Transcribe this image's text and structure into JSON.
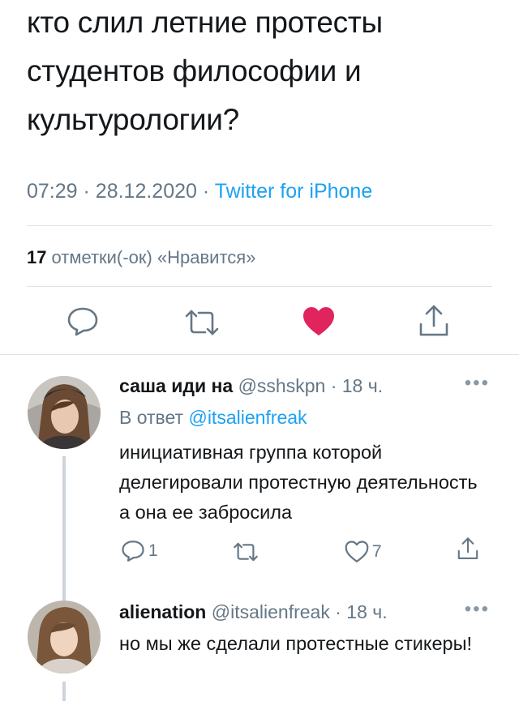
{
  "tweet": {
    "text": "кто слил летние протесты студентов философии и культурологии?",
    "time": "07:29",
    "separator": "·",
    "date": "28.12.2020",
    "source": "Twitter for iPhone",
    "likes_count": "17",
    "likes_label": "отметки(-ок) «Нравится»",
    "liked_color": "#e0245e"
  },
  "replies": [
    {
      "display_name": "саша иди на",
      "handle": "@sshskpn",
      "separator": "·",
      "age": "18 ч.",
      "reply_prefix": "В ответ",
      "reply_to": "@itsalienfreak",
      "text": "инициативная группа которой делегировали протестную деятельность а она ее забросила",
      "reply_count": "1",
      "like_count": "7"
    },
    {
      "display_name": "alienation",
      "handle": "@itsalienfreak",
      "separator": "·",
      "age": "18 ч.",
      "text": "но мы же сделали протестные стикеры!"
    }
  ],
  "icons": {
    "reply": "reply-icon",
    "retweet": "retweet-icon",
    "like": "heart-icon",
    "share": "share-icon",
    "more": "more-icon"
  }
}
